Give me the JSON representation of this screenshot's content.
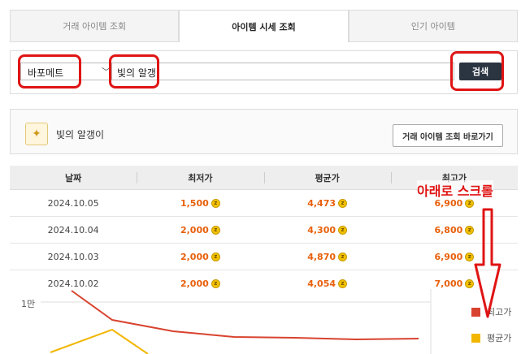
{
  "tabs": [
    {
      "label": "거래 아이템 조회"
    },
    {
      "label": "아이템 시세 조회"
    },
    {
      "label": "인기 아이템"
    }
  ],
  "search": {
    "server": "바포메트",
    "query": "빛의 알갱",
    "button_label": "검색"
  },
  "item": {
    "name": "빛의 알갱이",
    "goto_label": "거래 아이템 조회 바로가기"
  },
  "table": {
    "headers": [
      "날짜",
      "최저가",
      "평균가",
      "최고가"
    ],
    "rows": [
      {
        "date": "2024.10.05",
        "min": "1,500",
        "avg": "4,473",
        "max": "6,900"
      },
      {
        "date": "2024.10.04",
        "min": "2,000",
        "avg": "4,300",
        "max": "6,800"
      },
      {
        "date": "2024.10.03",
        "min": "2,000",
        "avg": "4,870",
        "max": "6,900"
      },
      {
        "date": "2024.10.02",
        "min": "2,000",
        "avg": "4,054",
        "max": "7,000"
      }
    ]
  },
  "chart": {
    "y_tick": "1만",
    "legend": [
      {
        "label": "최고가",
        "color": "#d8432f"
      },
      {
        "label": "평균가",
        "color": "#f2b600"
      }
    ]
  },
  "annotation": {
    "text": "아래로 스크롤"
  },
  "colors": {
    "highlight": "#e01414",
    "price": "#e8600c",
    "search_button": "#2b3441"
  }
}
